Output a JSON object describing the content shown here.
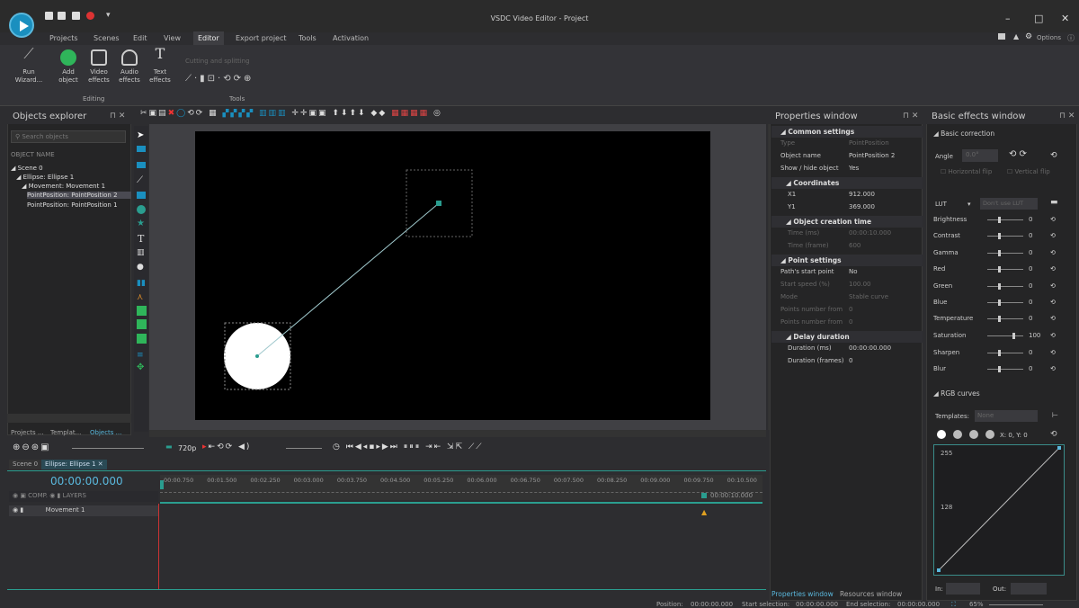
{
  "app": {
    "title": "VSDC Video Editor - Project",
    "options_label": "Options"
  },
  "menu": [
    "Projects",
    "Scenes",
    "Edit",
    "View",
    "Editor",
    "Export project",
    "Tools",
    "Activation"
  ],
  "menu_active": "Editor",
  "ribbon": {
    "buttons": [
      {
        "label": "Run",
        "label2": "Wizard...",
        "icon": "wand-icon"
      },
      {
        "label": "Add",
        "label2": "object",
        "icon": "plus-circle-icon"
      },
      {
        "label": "Video",
        "label2": "effects",
        "icon": "video-effects-icon"
      },
      {
        "label": "Audio",
        "label2": "effects",
        "icon": "headphones-icon"
      },
      {
        "label": "Text",
        "label2": "effects",
        "icon": "text-effects-icon"
      }
    ],
    "editing_label": "Editing",
    "cutting_label": "Cutting and splitting",
    "tools_label": "Tools"
  },
  "objects_explorer": {
    "title": "Objects explorer",
    "search_placeholder": "Search objects",
    "column": "OBJECT NAME",
    "tree": [
      "Scene 0",
      "Ellipse: Ellipse 1",
      "Movement: Movement 1",
      "PointPosition: PointPosition 2",
      "PointPosition: PointPosition 1"
    ],
    "tabs": [
      "Projects ...",
      "Templat...",
      "Objects ..."
    ]
  },
  "properties": {
    "title": "Properties window",
    "common_settings": "Common settings",
    "rows_common": [
      {
        "k": "Type",
        "v": "PointPosition",
        "dim": true
      },
      {
        "k": "Object name",
        "v": "PointPosition 2",
        "dim": false
      },
      {
        "k": "Show / hide object",
        "v": "Yes",
        "dim": false
      }
    ],
    "coordinates": "Coordinates",
    "rows_coord": [
      {
        "k": "X1",
        "v": "912.000"
      },
      {
        "k": "Y1",
        "v": "369.000"
      }
    ],
    "creation_time": "Object creation time",
    "rows_time": [
      {
        "k": "Time (ms)",
        "v": "00:00:10.000"
      },
      {
        "k": "Time (frame)",
        "v": "600"
      }
    ],
    "point_settings": "Point settings",
    "rows_point": [
      {
        "k": "Path's start point",
        "v": "No",
        "dim": false
      },
      {
        "k": "Start speed (%)",
        "v": "100.00",
        "dim": true
      },
      {
        "k": "Mode",
        "v": "Stable curve",
        "dim": true
      },
      {
        "k": "Points number from",
        "v": "0",
        "dim": true
      },
      {
        "k": "Points number from",
        "v": "0",
        "dim": true
      }
    ],
    "delay_duration": "Delay duration",
    "rows_delay": [
      {
        "k": "Duration (ms)",
        "v": "00:00:00.000"
      },
      {
        "k": "Duration (frames)",
        "v": "0"
      }
    ],
    "bottom_tabs": [
      "Properties window",
      "Resources window"
    ]
  },
  "effects": {
    "title": "Basic effects window",
    "basic_correction": "Basic correction",
    "angle_label": "Angle",
    "angle_value": "0.0°",
    "hflip": "Horizontal flip",
    "vflip": "Vertical flip",
    "lut_label": "LUT",
    "lut_value": "Don't use LUT",
    "sliders": [
      {
        "label": "Brightness",
        "value": "0"
      },
      {
        "label": "Contrast",
        "value": "0"
      },
      {
        "label": "Gamma",
        "value": "0"
      },
      {
        "label": "Red",
        "value": "0"
      },
      {
        "label": "Green",
        "value": "0"
      },
      {
        "label": "Blue",
        "value": "0"
      },
      {
        "label": "Temperature",
        "value": "0"
      },
      {
        "label": "Saturation",
        "value": "100"
      },
      {
        "label": "Sharpen",
        "value": "0"
      },
      {
        "label": "Blur",
        "value": "0"
      }
    ],
    "rgb_curves": "RGB curves",
    "templates_label": "Templates:",
    "templates_value": "None",
    "xy_label": "X: 0, Y: 0",
    "curve_top": "255",
    "curve_mid": "128",
    "in_label": "In:",
    "out_label": "Out:"
  },
  "timeline": {
    "zoom": "720p",
    "tabs": [
      "Scene 0",
      "Ellipse: Ellipse 1"
    ],
    "time": "00:00:00.000",
    "layers_header": "LAYERS",
    "comp_label": "COMP.",
    "track": "Movement 1",
    "ruler": [
      "00:00.750",
      "00:01.500",
      "00:02.250",
      "00:03.000",
      "00:03.750",
      "00:04.500",
      "00:05.250",
      "00:06.000",
      "00:06.750",
      "00:07.500",
      "00:08.250",
      "00:09.000",
      "00:09.750",
      "00:10.500"
    ],
    "end_marker": "00:00:10.000"
  },
  "status": {
    "position_label": "Position:",
    "position": "00:00:00.000",
    "start_sel_label": "Start selection:",
    "start_sel": "00:00:00.000",
    "end_sel_label": "End selection:",
    "end_sel": "00:00:00.000",
    "zoom": "65%"
  },
  "colors": {
    "accent": "#1a8fbf",
    "teal": "#2a9d8f",
    "panel": "#252526",
    "bg": "#2d2d30"
  }
}
